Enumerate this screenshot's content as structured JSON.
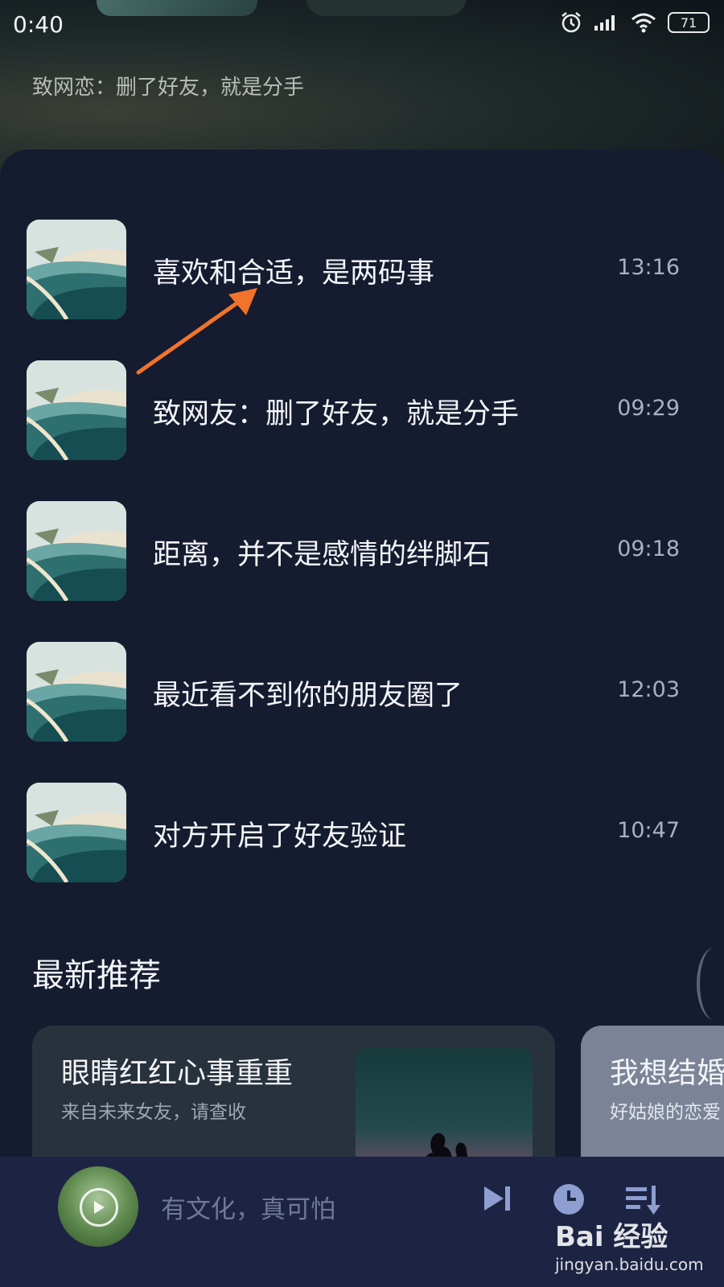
{
  "status_bar": {
    "time": "0:40",
    "battery": "71"
  },
  "header": {
    "subtitle": "致网恋：删了好友，就是分手"
  },
  "list": [
    {
      "title": "喜欢和合适，是两码事",
      "time": "13:16"
    },
    {
      "title": "致网友：删了好友，就是分手",
      "time": "09:29"
    },
    {
      "title": "距离，并不是感情的绊脚石",
      "time": "09:18"
    },
    {
      "title": "最近看不到你的朋友圈了",
      "time": "12:03"
    },
    {
      "title": "对方开启了好友验证",
      "time": "10:47"
    }
  ],
  "section": {
    "title": "最新推荐"
  },
  "cards": [
    {
      "title": "眼睛红红心事重重",
      "subtitle": "来自未来女友，请查收"
    },
    {
      "title": "我想结婚",
      "subtitle": "好姑娘的恋爱"
    }
  ],
  "player": {
    "title": "有文化，真可怕"
  },
  "watermark": {
    "main": "Bai 经验",
    "sub": "jingyan.baidu.com"
  },
  "colors": {
    "background": "#151c30",
    "player_bar": "#1d2443",
    "arrow": "#f0742c"
  }
}
